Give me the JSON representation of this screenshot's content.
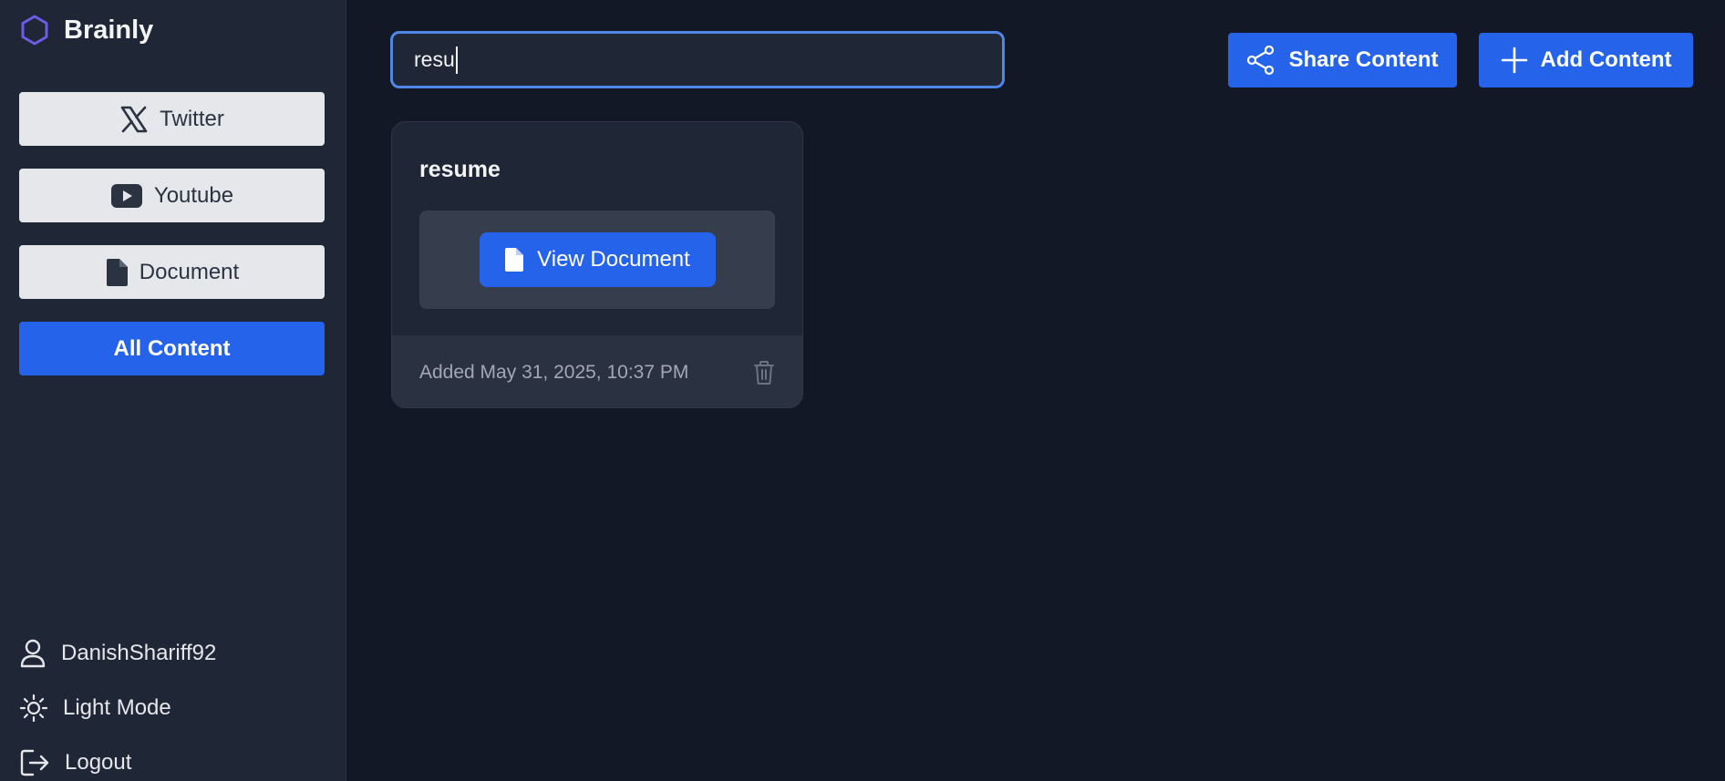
{
  "app": {
    "name": "Brainly",
    "accent_color": "#2563eb",
    "logo_icon": "hexagon-logo-icon"
  },
  "sidebar": {
    "filters": [
      {
        "label": "Twitter",
        "icon": "x-logo-icon"
      },
      {
        "label": "Youtube",
        "icon": "youtube-icon"
      },
      {
        "label": "Document",
        "icon": "document-icon"
      },
      {
        "label": "All Content",
        "active": true
      }
    ],
    "footer": {
      "username": "DanishShariff92",
      "theme_toggle": "Light Mode",
      "logout": "Logout"
    }
  },
  "header": {
    "search_value": "resu",
    "share_label": "Share Content",
    "add_label": "Add Content"
  },
  "cards": [
    {
      "title": "resume",
      "action_label": "View Document",
      "added": "Added May 31, 2025, 10:37 PM"
    }
  ]
}
